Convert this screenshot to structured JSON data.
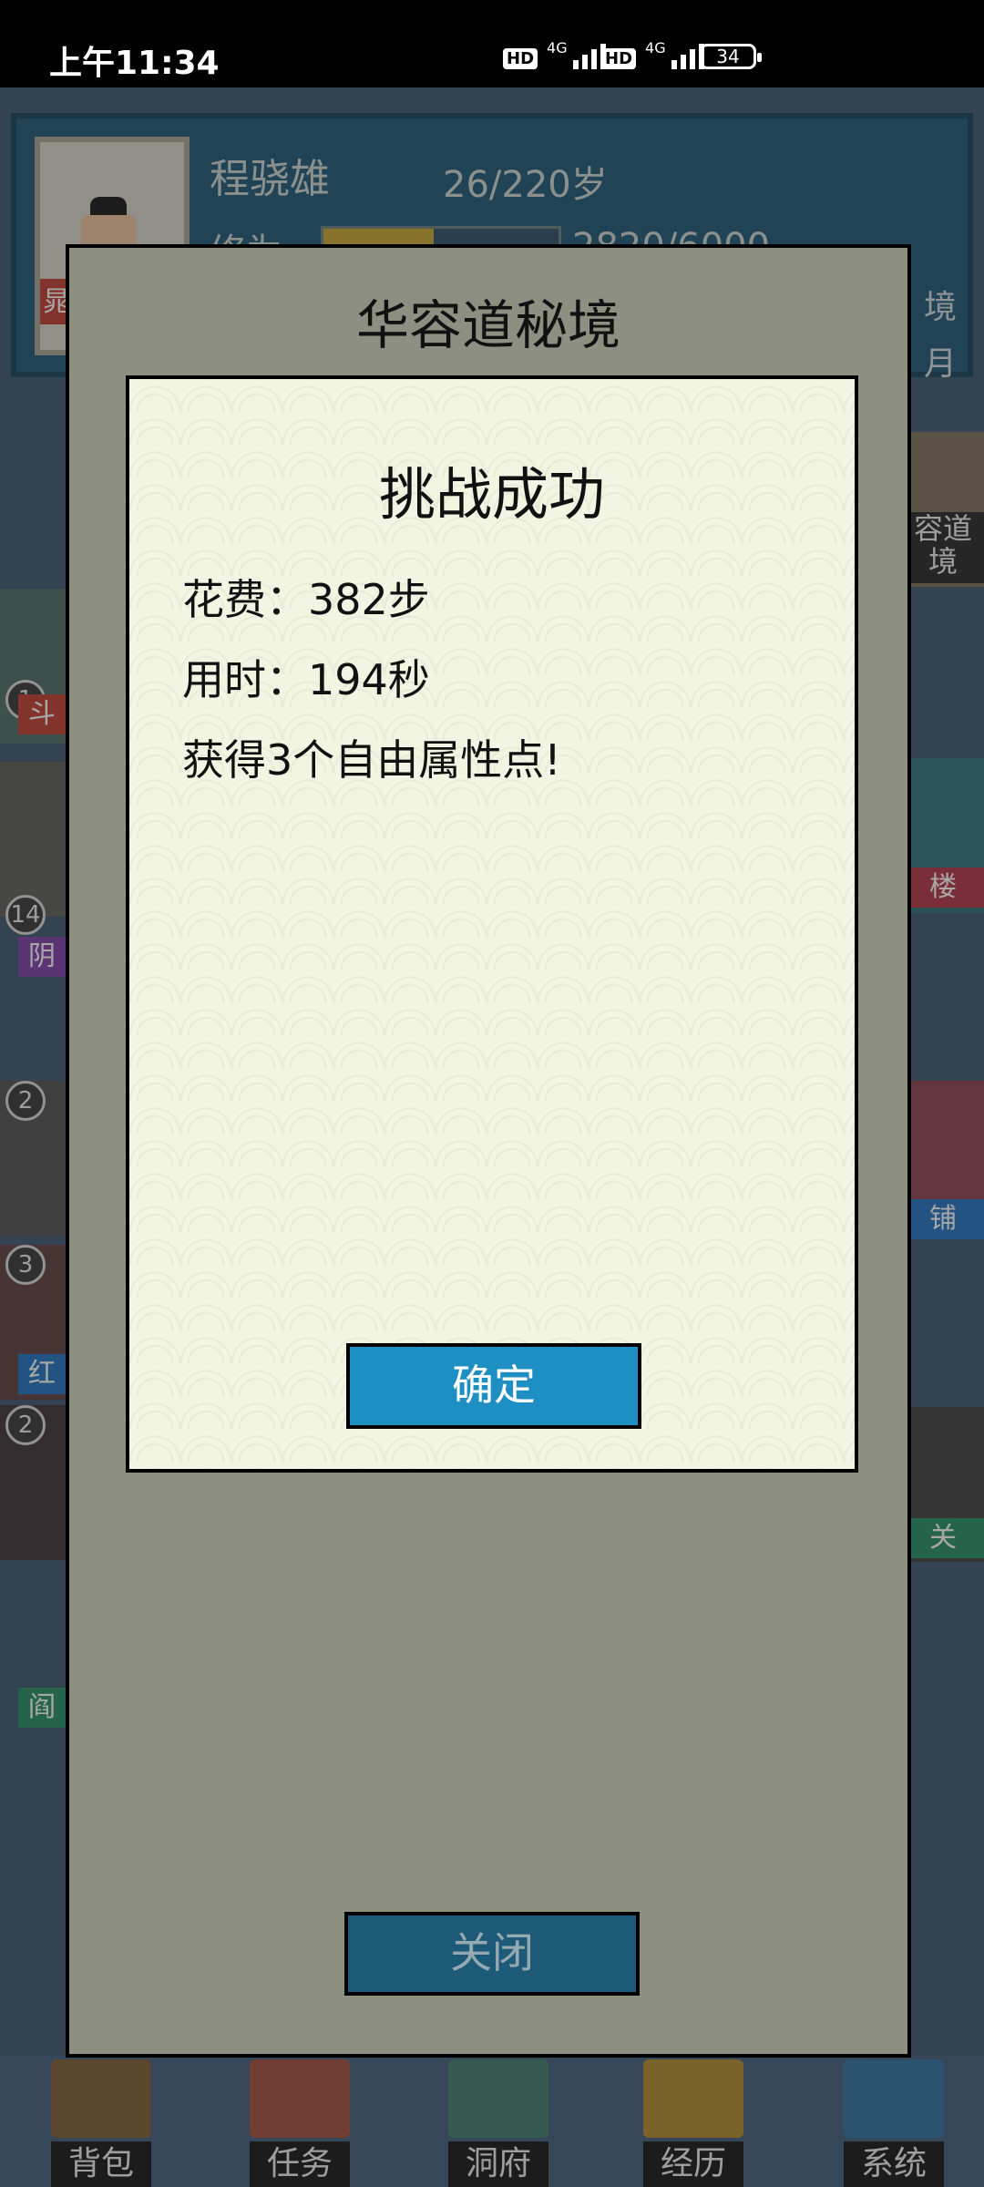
{
  "status_bar": {
    "time": "上午11:34",
    "hd1": "HD",
    "net1": "4G",
    "hd2": "HD",
    "net2": "4G",
    "battery": "34"
  },
  "profile": {
    "name": "程骁雄",
    "age": "26/220岁",
    "cultivation_label": "修为:",
    "cultivation_value": "2820/6000",
    "cultivation_progress": 0.47,
    "avatar_tag": "晁",
    "right_text_1": "境",
    "right_text_2": "月"
  },
  "side_tiles": {
    "left": [
      {
        "num": "1",
        "tag": "斗",
        "color": "#c0392b"
      },
      {
        "num": "14",
        "tag": "阴",
        "color": "#7d3ca6"
      },
      {
        "num": "2",
        "tag": "",
        "color": ""
      },
      {
        "num": "3",
        "tag": "红",
        "color": "#1a6fc1"
      },
      {
        "num": "2",
        "tag": "阎",
        "color": "#1f8a63"
      }
    ],
    "right": [
      "容道",
      "境",
      "楼",
      "铺",
      "关"
    ]
  },
  "outer_dialog": {
    "title": "华容道秘境",
    "close_label": "关闭"
  },
  "result_dialog": {
    "title": "挑战成功",
    "cost": "花费：382步",
    "time": "用时：194秒",
    "reward": "获得3个自由属性点!",
    "confirm_label": "确定"
  },
  "bottom_nav": [
    {
      "label": "背包",
      "icon": "backpack-icon",
      "color": "#7a5a2d"
    },
    {
      "label": "任务",
      "icon": "scroll-icon",
      "color": "#a44a3a"
    },
    {
      "label": "洞府",
      "icon": "pagoda-icon",
      "color": "#3d7b6a"
    },
    {
      "label": "经历",
      "icon": "book-icon",
      "color": "#b08a2a"
    },
    {
      "label": "系统",
      "icon": "gear-icon",
      "color": "#2a6fa0"
    }
  ]
}
